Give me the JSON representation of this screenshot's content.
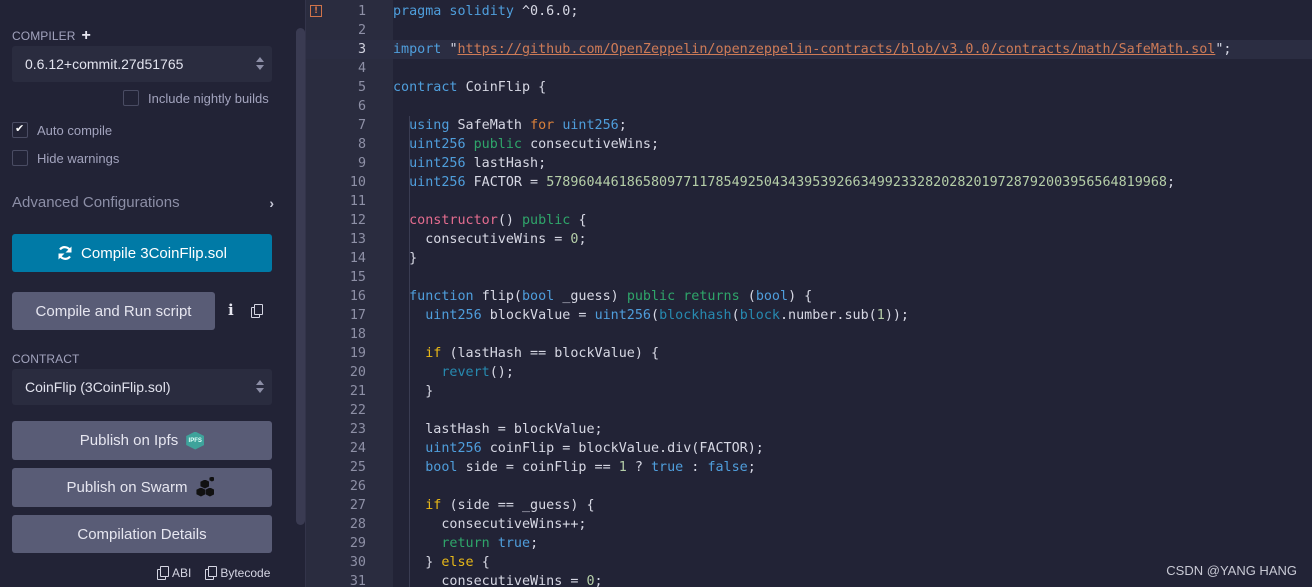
{
  "compiler": {
    "section_label": "COMPILER",
    "add_icon": "plus-icon",
    "version": "0.6.12+commit.27d51765",
    "include_nightly_label": "Include nightly builds",
    "include_nightly_checked": false,
    "auto_compile_label": "Auto compile",
    "auto_compile_checked": true,
    "hide_warnings_label": "Hide warnings",
    "hide_warnings_checked": false,
    "advanced_label": "Advanced Configurations",
    "compile_button": "Compile 3CoinFlip.sol",
    "compile_run_button": "Compile and Run script"
  },
  "contract": {
    "section_label": "CONTRACT",
    "selected": "CoinFlip (3CoinFlip.sol)",
    "publish_ipfs": "Publish on Ipfs",
    "ipfs_badge": "IPFS",
    "publish_swarm": "Publish on Swarm",
    "details": "Compilation Details",
    "abi_label": "ABI",
    "bytecode_label": "Bytecode"
  },
  "editor": {
    "active_line": 3,
    "lines": [
      [
        [
          "k-blue",
          "pragma solidity "
        ],
        [
          "plain",
          "^0.6.0;"
        ]
      ],
      [],
      [
        [
          "k-blue",
          "import "
        ],
        [
          "plain",
          "\""
        ],
        [
          "str",
          "https://github.com/OpenZeppelin/openzeppelin-contracts/blob/v3.0.0/contracts/math/SafeMath.sol"
        ],
        [
          "plain",
          "\";"
        ]
      ],
      [],
      [
        [
          "k-blue",
          "contract "
        ],
        [
          "plain",
          "CoinFlip {"
        ]
      ],
      [],
      [
        [
          "plain",
          "  "
        ],
        [
          "k-blue",
          "using "
        ],
        [
          "plain",
          "SafeMath "
        ],
        [
          "k-orange",
          "for "
        ],
        [
          "k-blue",
          "uint256"
        ],
        [
          "plain",
          ";"
        ]
      ],
      [
        [
          "plain",
          "  "
        ],
        [
          "k-blue",
          "uint256 "
        ],
        [
          "k-green",
          "public "
        ],
        [
          "plain",
          "consecutiveWins;"
        ]
      ],
      [
        [
          "plain",
          "  "
        ],
        [
          "k-blue",
          "uint256 "
        ],
        [
          "plain",
          "lastHash;"
        ]
      ],
      [
        [
          "plain",
          "  "
        ],
        [
          "k-blue",
          "uint256 "
        ],
        [
          "plain",
          "FACTOR = "
        ],
        [
          "num",
          "57896044618658097711785492504343953926634992332820282019728792003956564819968"
        ],
        [
          "plain",
          ";"
        ]
      ],
      [],
      [
        [
          "plain",
          "  "
        ],
        [
          "k-pink",
          "constructor"
        ],
        [
          "plain",
          "() "
        ],
        [
          "k-green",
          "public "
        ],
        [
          "plain",
          "{"
        ]
      ],
      [
        [
          "plain",
          "    consecutiveWins = "
        ],
        [
          "num",
          "0"
        ],
        [
          "plain",
          ";"
        ]
      ],
      [
        [
          "plain",
          "  }"
        ]
      ],
      [],
      [
        [
          "plain",
          "  "
        ],
        [
          "k-blue",
          "function "
        ],
        [
          "plain",
          "flip("
        ],
        [
          "k-blue",
          "bool "
        ],
        [
          "plain",
          "_guess) "
        ],
        [
          "k-green",
          "public returns "
        ],
        [
          "plain",
          "("
        ],
        [
          "k-blue",
          "bool"
        ],
        [
          "plain",
          ") {"
        ]
      ],
      [
        [
          "plain",
          "    "
        ],
        [
          "k-blue",
          "uint256 "
        ],
        [
          "plain",
          "blockValue = "
        ],
        [
          "k-blue",
          "uint256"
        ],
        [
          "plain",
          "("
        ],
        [
          "k-teal",
          "blockhash"
        ],
        [
          "plain",
          "("
        ],
        [
          "k-teal",
          "block"
        ],
        [
          "plain",
          ".number.sub("
        ],
        [
          "num",
          "1"
        ],
        [
          "plain",
          "));"
        ]
      ],
      [],
      [
        [
          "plain",
          "    "
        ],
        [
          "k-yellow",
          "if "
        ],
        [
          "plain",
          "(lastHash == blockValue) {"
        ]
      ],
      [
        [
          "plain",
          "      "
        ],
        [
          "k-teal",
          "revert"
        ],
        [
          "plain",
          "();"
        ]
      ],
      [
        [
          "plain",
          "    }"
        ]
      ],
      [],
      [
        [
          "plain",
          "    lastHash = blockValue;"
        ]
      ],
      [
        [
          "plain",
          "    "
        ],
        [
          "k-blue",
          "uint256 "
        ],
        [
          "plain",
          "coinFlip = blockValue.div(FACTOR);"
        ]
      ],
      [
        [
          "plain",
          "    "
        ],
        [
          "k-blue",
          "bool "
        ],
        [
          "plain",
          "side = coinFlip == "
        ],
        [
          "num",
          "1"
        ],
        [
          "plain",
          " ? "
        ],
        [
          "k-blue",
          "true"
        ],
        [
          "plain",
          " : "
        ],
        [
          "k-blue",
          "false"
        ],
        [
          "plain",
          ";"
        ]
      ],
      [],
      [
        [
          "plain",
          "    "
        ],
        [
          "k-yellow",
          "if "
        ],
        [
          "plain",
          "(side == _guess) {"
        ]
      ],
      [
        [
          "plain",
          "      consecutiveWins++;"
        ]
      ],
      [
        [
          "plain",
          "      "
        ],
        [
          "k-green",
          "return "
        ],
        [
          "k-blue",
          "true"
        ],
        [
          "plain",
          ";"
        ]
      ],
      [
        [
          "plain",
          "    } "
        ],
        [
          "k-yellow",
          "else "
        ],
        [
          "plain",
          "{"
        ]
      ],
      [
        [
          "plain",
          "      consecutiveWins = "
        ],
        [
          "num",
          "0"
        ],
        [
          "plain",
          ";"
        ]
      ]
    ]
  },
  "watermark": "CSDN @YANG HANG"
}
